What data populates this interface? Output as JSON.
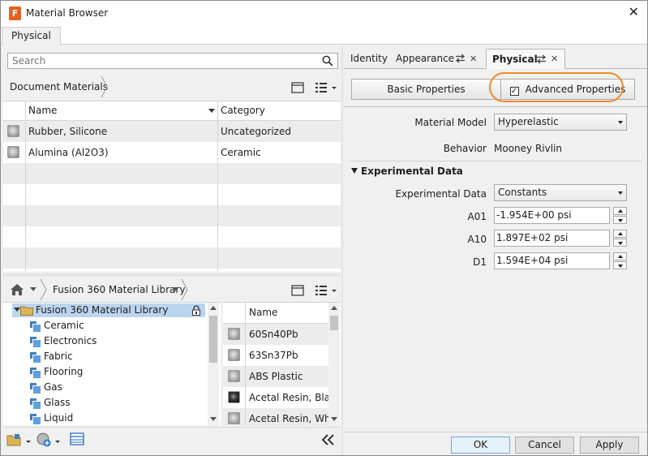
{
  "window": {
    "title": "Material Browser",
    "app_icon_letter": "F"
  },
  "top_tabs": [
    {
      "label": "Physical"
    }
  ],
  "search": {
    "placeholder": "Search",
    "value": ""
  },
  "document_materials": {
    "breadcrumb": "Document Materials",
    "columns": {
      "name": "Name",
      "category": "Category"
    },
    "rows": [
      {
        "name": "Rubber, Silicone",
        "category": "Uncategorized"
      },
      {
        "name": "Alumina (Al2O3)",
        "category": "Ceramic"
      }
    ]
  },
  "library": {
    "breadcrumb": "Fusion 360 Material Library",
    "tree_root": "Fusion 360 Material Library",
    "categories": [
      "Ceramic",
      "Electronics",
      "Fabric",
      "Flooring",
      "Gas",
      "Glass",
      "Liquid"
    ],
    "list_header": "Name",
    "materials": [
      {
        "name": "60Sn40Pb",
        "icon": "gray"
      },
      {
        "name": "63Sn37Pb",
        "icon": "gray"
      },
      {
        "name": "ABS Plastic",
        "icon": "gray"
      },
      {
        "name": "Acetal Resin, Black",
        "icon": "dark"
      },
      {
        "name": "Acetal Resin, White",
        "icon": "gray"
      }
    ]
  },
  "right_tabs": {
    "identity": "Identity",
    "appearance": "Appearance",
    "physical": "Physical"
  },
  "properties": {
    "basic_label": "Basic Properties",
    "advanced_label": "Advanced Properties",
    "advanced_checked": true,
    "material_model_label": "Material Model",
    "material_model_value": "Hyperelastic",
    "behavior_label": "Behavior",
    "behavior_value": "Mooney Rivlin",
    "section_title": "Experimental Data",
    "experimental_label": "Experimental Data",
    "experimental_value": "Constants",
    "fields": [
      {
        "label": "A01",
        "value": "-1.954E+00 psi"
      },
      {
        "label": "A10",
        "value": "1.897E+02 psi"
      },
      {
        "label": "D1",
        "value": "1.594E+04 psi"
      }
    ]
  },
  "footer": {
    "ok": "OK",
    "cancel": "Cancel",
    "apply": "Apply"
  },
  "colors": {
    "highlight_ring": "#ef8a2c",
    "tree_selection": "#bcd5ef",
    "app_icon": "#e2621e"
  }
}
